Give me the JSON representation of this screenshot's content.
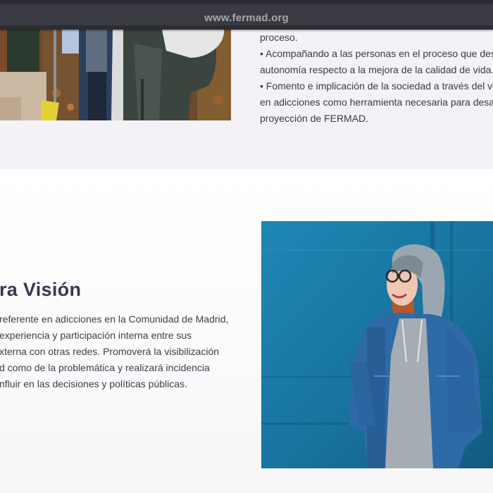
{
  "browser": {
    "url": "www.fermad.org"
  },
  "top_section": {
    "bullet_lines": [
      "proceso.",
      "• Acompañando a las personas en el proceso que desa",
      "autonomía respecto a la mejora de la calidad de vida.",
      "• Fomento e implicación de la sociedad a través del vo",
      "en adicciones como herramienta necesaria para desar",
      "proyección de FERMAD."
    ]
  },
  "vision_section": {
    "title": "ra Visión",
    "paragraph_lines": [
      "referente en adicciones en la Comunidad de Madrid,",
      "experiencia y participación interna entre sus",
      "xterna con otras redes. Promoverá la visibilización",
      "d como de la problemática y realizará incidencia",
      "nfluir en las decisiones y políticas públicas."
    ]
  },
  "colors": {
    "topbar": "#2c2c33",
    "heading": "#3a3650",
    "photo_background": "#1c7aa8"
  }
}
